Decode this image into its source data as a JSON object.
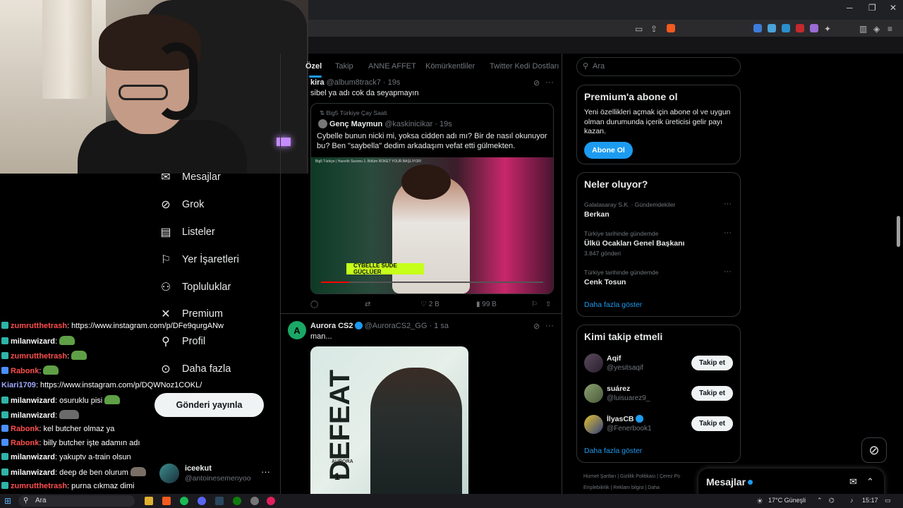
{
  "browser": {
    "window_controls": [
      "─",
      "❐",
      "✕"
    ]
  },
  "nav": {
    "items": [
      {
        "label": "Mesajlar",
        "icon": "envelope-icon"
      },
      {
        "label": "Grok",
        "icon": "grok-icon"
      },
      {
        "label": "Listeler",
        "icon": "list-icon"
      },
      {
        "label": "Yer İşaretleri",
        "icon": "bookmark-icon"
      },
      {
        "label": "Topluluklar",
        "icon": "communities-icon"
      },
      {
        "label": "Premium",
        "icon": "x-logo-icon"
      },
      {
        "label": "Profil",
        "icon": "person-icon"
      },
      {
        "label": "Daha fazla",
        "icon": "more-circle-icon"
      }
    ],
    "post_button": "Gönderi yayınla",
    "account": {
      "name": "iceekut",
      "handle": "@antoinesemenyoo",
      "more": "···"
    }
  },
  "chat": {
    "lines": [
      {
        "user": "zumrutthetrash",
        "color": "#ff4d4d",
        "message": ": https://www.instagram.com/p/DFe9qurgANw",
        "emote": false
      },
      {
        "user": "milanwizard",
        "color": "#ffffff",
        "message": ":",
        "emote": true
      },
      {
        "user": "zumrutthetrash",
        "color": "#ff4d4d",
        "message": ":",
        "emote": true
      },
      {
        "user": "Rabonk",
        "color": "#ff4d4d",
        "message": ":",
        "emote": true
      },
      {
        "user": "Kiari1709",
        "color": "#9fa8ff",
        "message": ": https://www.instagram.com/p/DQWNoz1COKL/",
        "emote": false
      },
      {
        "user": "milanwizard",
        "color": "#ffffff",
        "message": ": osuruklu pisi",
        "emote": true
      },
      {
        "user": "milanwizard",
        "color": "#ffffff",
        "message": ":",
        "emote": true
      },
      {
        "user": "Rabonk",
        "color": "#ff4d4d",
        "message": ": kel butcher olmaz ya",
        "emote": false
      },
      {
        "user": "Rabonk",
        "color": "#ff4d4d",
        "message": ": billy butcher işte adamın adı",
        "emote": false
      },
      {
        "user": "milanwizard",
        "color": "#ffffff",
        "message": ": yakuptv a-train olsun",
        "emote": false
      },
      {
        "user": "milanwizard",
        "color": "#ffffff",
        "message": ": deep de ben olurum",
        "emote": true
      },
      {
        "user": "zumrutthetrash",
        "color": "#ff4d4d",
        "message": ": purna cıkmaz dimi",
        "emote": false
      }
    ]
  },
  "timeline": {
    "tabs": [
      "Özel",
      "Takip",
      "ANNE AFFET",
      "Kömürkentliler",
      "Twitter Kedi Dostları"
    ],
    "tweet1": {
      "name": "kira",
      "handle": "@album8track7 · 19s",
      "text": "sibel ya adı cok da seyapmayın",
      "quote": {
        "community": "Big5 Türkiye Çay Saati",
        "name": "Genç Maymun",
        "handle": "@kaskinicikar · 19s",
        "text": "Cybelle bunun nicki mi, yoksa cidden adı mı? Bir de nasıl okunuyor bu? Ben \"saybella\" dedim arkadaşım vefat etti gülmekten.",
        "video_caption": "CYBELLE SUDE GÜÇLÜER",
        "video_topbar": "Big5 Türkiye | Hazırlık Sezonu 1. Bölüm ROKET YOUR BAŞLIYOR!"
      },
      "actions": {
        "reply": "",
        "retweet": "",
        "likes": "2 B",
        "views": "99 B"
      }
    },
    "tweet2": {
      "name": "Aurora CS2",
      "handle": "@AuroraCS2_GG · 1 sa",
      "text": "man...",
      "poster_word": "DEFEAT",
      "poster_tag": "AURORA",
      "poster_num": "1"
    }
  },
  "sidebar": {
    "search_placeholder": "Ara",
    "premium": {
      "title": "Premium'a abone ol",
      "text": "Yeni özellikleri açmak için abone ol ve uygun olman durumunda içerik üreticisi gelir payı kazan.",
      "button": "Abone Ol"
    },
    "trends": {
      "title": "Neler oluyor?",
      "items": [
        {
          "category": "Galatasaray S.K. · Gündemdekiler",
          "name": "Berkan",
          "count": ""
        },
        {
          "category": "Türkiye tarihinde gündemde",
          "name": "Ülkü Ocakları Genel Başkanı",
          "count": "3.847 gönderi"
        },
        {
          "category": "Türkiye tarihinde gündemde",
          "name": "Cenk Tosun",
          "count": ""
        }
      ],
      "more_link": "Daha fazla göster"
    },
    "who_to_follow": {
      "title": "Kimi takip etmeli",
      "items": [
        {
          "name": "Aqif",
          "handle": "@yesitsaqif",
          "verified": false,
          "button": "Takip et"
        },
        {
          "name": "suárez",
          "handle": "@luisuarez9_",
          "verified": false,
          "button": "Takip et"
        },
        {
          "name": "İlyasCB",
          "handle": "@Fenerbook1",
          "verified": true,
          "button": "Takip et"
        }
      ],
      "more_link": "Daha fazla göster"
    },
    "footer": {
      "line1": "Hizmet Şartları  |  Gizlilik Politikası  |  Çerez Po",
      "line2": "Erişilebilirlik  |  Reklam bilgisi  |  Daha"
    }
  },
  "messages_drawer": {
    "title": "Mesajlar"
  },
  "taskbar": {
    "search": "Ara",
    "weather": "17°C  Güneşli",
    "time": "15:17"
  },
  "colors": {
    "accent": "#1d9bf0",
    "bg": "#000000",
    "border": "#2f3336",
    "muted": "#71767b"
  }
}
